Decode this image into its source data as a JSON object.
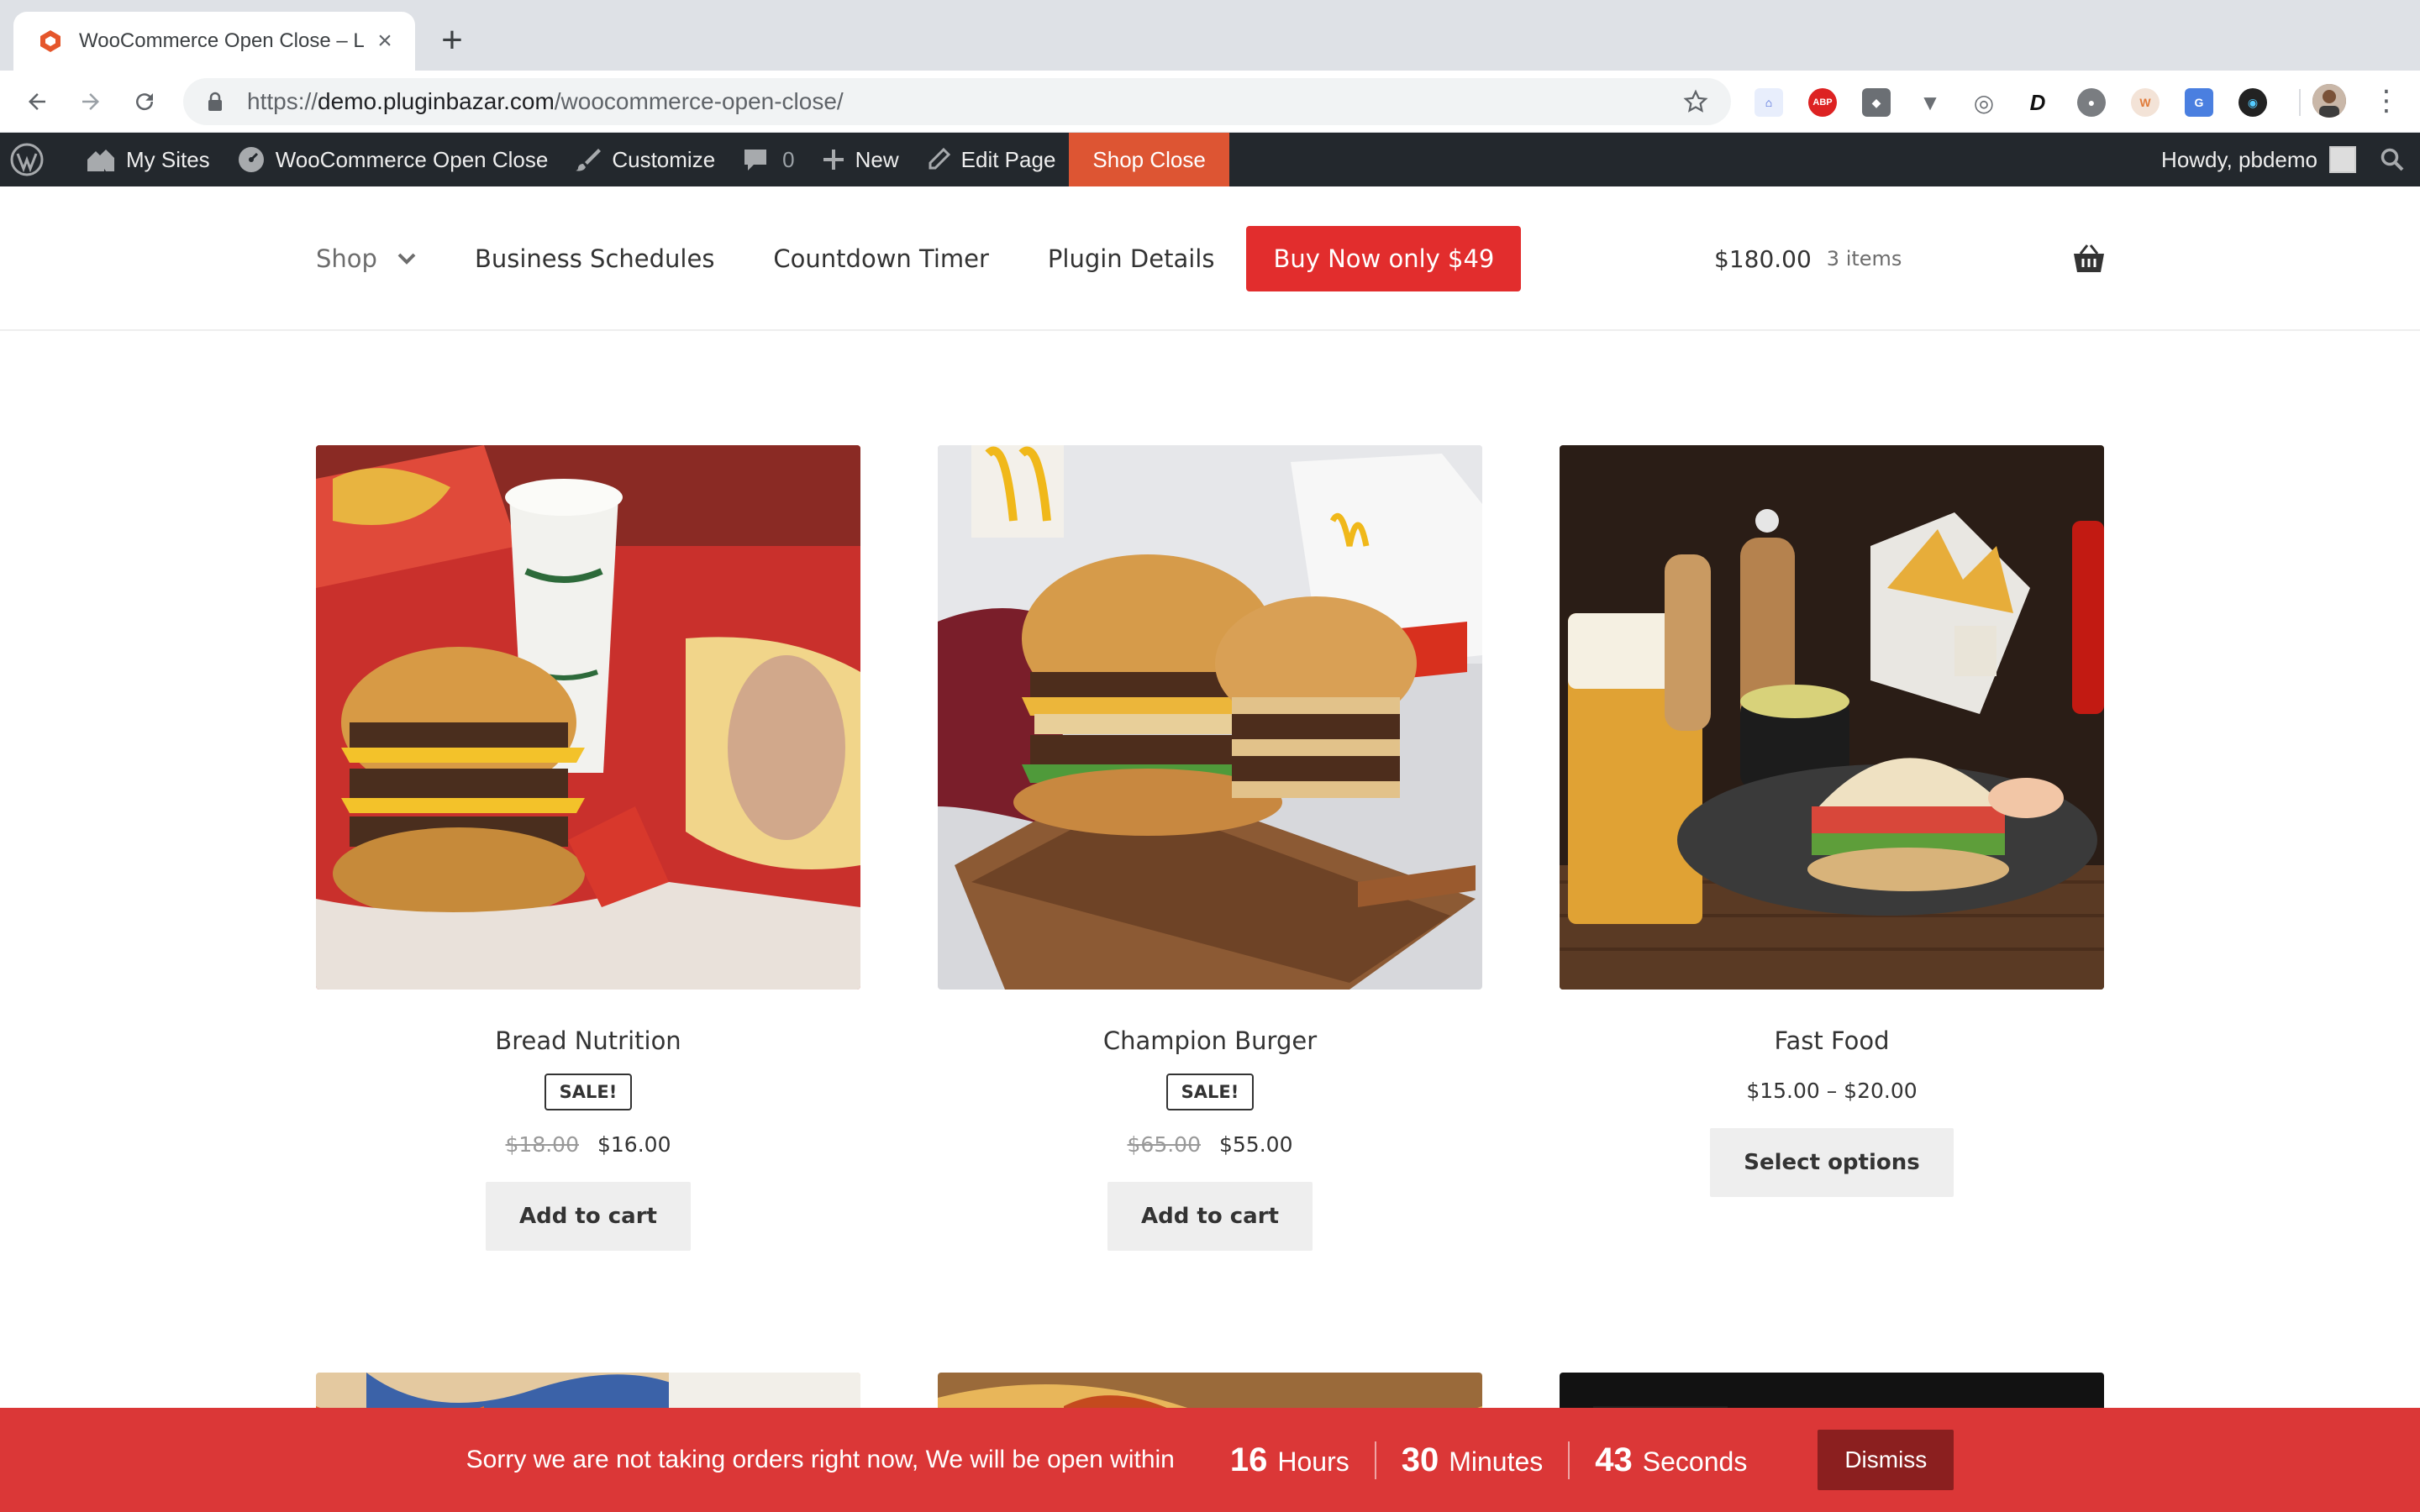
{
  "browser": {
    "tab_title": "WooCommerce Open Close – L",
    "url_scheme": "https://",
    "url_host": "demo.pluginbazar.com",
    "url_path": "/woocommerce-open-close/"
  },
  "adminbar": {
    "my_sites": "My Sites",
    "site_name": "WooCommerce Open Close",
    "customize": "Customize",
    "comments_count": "0",
    "new": "New",
    "edit_page": "Edit Page",
    "shop_close": "Shop Close",
    "howdy": "Howdy, pbdemo"
  },
  "nav": {
    "shop": "Shop",
    "business_schedules": "Business Schedules",
    "countdown_timer": "Countdown Timer",
    "plugin_details": "Plugin Details",
    "buy_now": "Buy Now only $49"
  },
  "cart": {
    "amount": "$180.00",
    "items": "3 items"
  },
  "products": [
    {
      "name": "Bread Nutrition",
      "sale_badge": "SALE!",
      "old_price": "$18.00",
      "price": "$16.00",
      "button": "Add to cart"
    },
    {
      "name": "Champion Burger",
      "sale_badge": "SALE!",
      "old_price": "$65.00",
      "price": "$55.00",
      "button": "Add to cart"
    },
    {
      "name": "Fast Food",
      "price_range": "$15.00 – $20.00",
      "button": "Select options"
    }
  ],
  "notice": {
    "message": "Sorry we are not taking orders right now, We will be open within",
    "hours": "16",
    "hours_label": "Hours",
    "minutes": "30",
    "minutes_label": "Minutes",
    "seconds": "43",
    "seconds_label": "Seconds",
    "dismiss": "Dismiss"
  },
  "colors": {
    "admin_bar": "#23282d",
    "shop_close_accent": "#dd5533",
    "buy_now": "#e22d2d",
    "notice_bar": "#db3737"
  },
  "icons": [
    "back-icon",
    "forward-icon",
    "reload-icon",
    "lock-icon",
    "star-icon",
    "wordpress-icon",
    "my-sites-icon",
    "dashboard-icon",
    "brush-icon",
    "comment-icon",
    "plus-icon",
    "pencil-icon",
    "search-icon",
    "chevron-down-icon",
    "basket-icon"
  ]
}
